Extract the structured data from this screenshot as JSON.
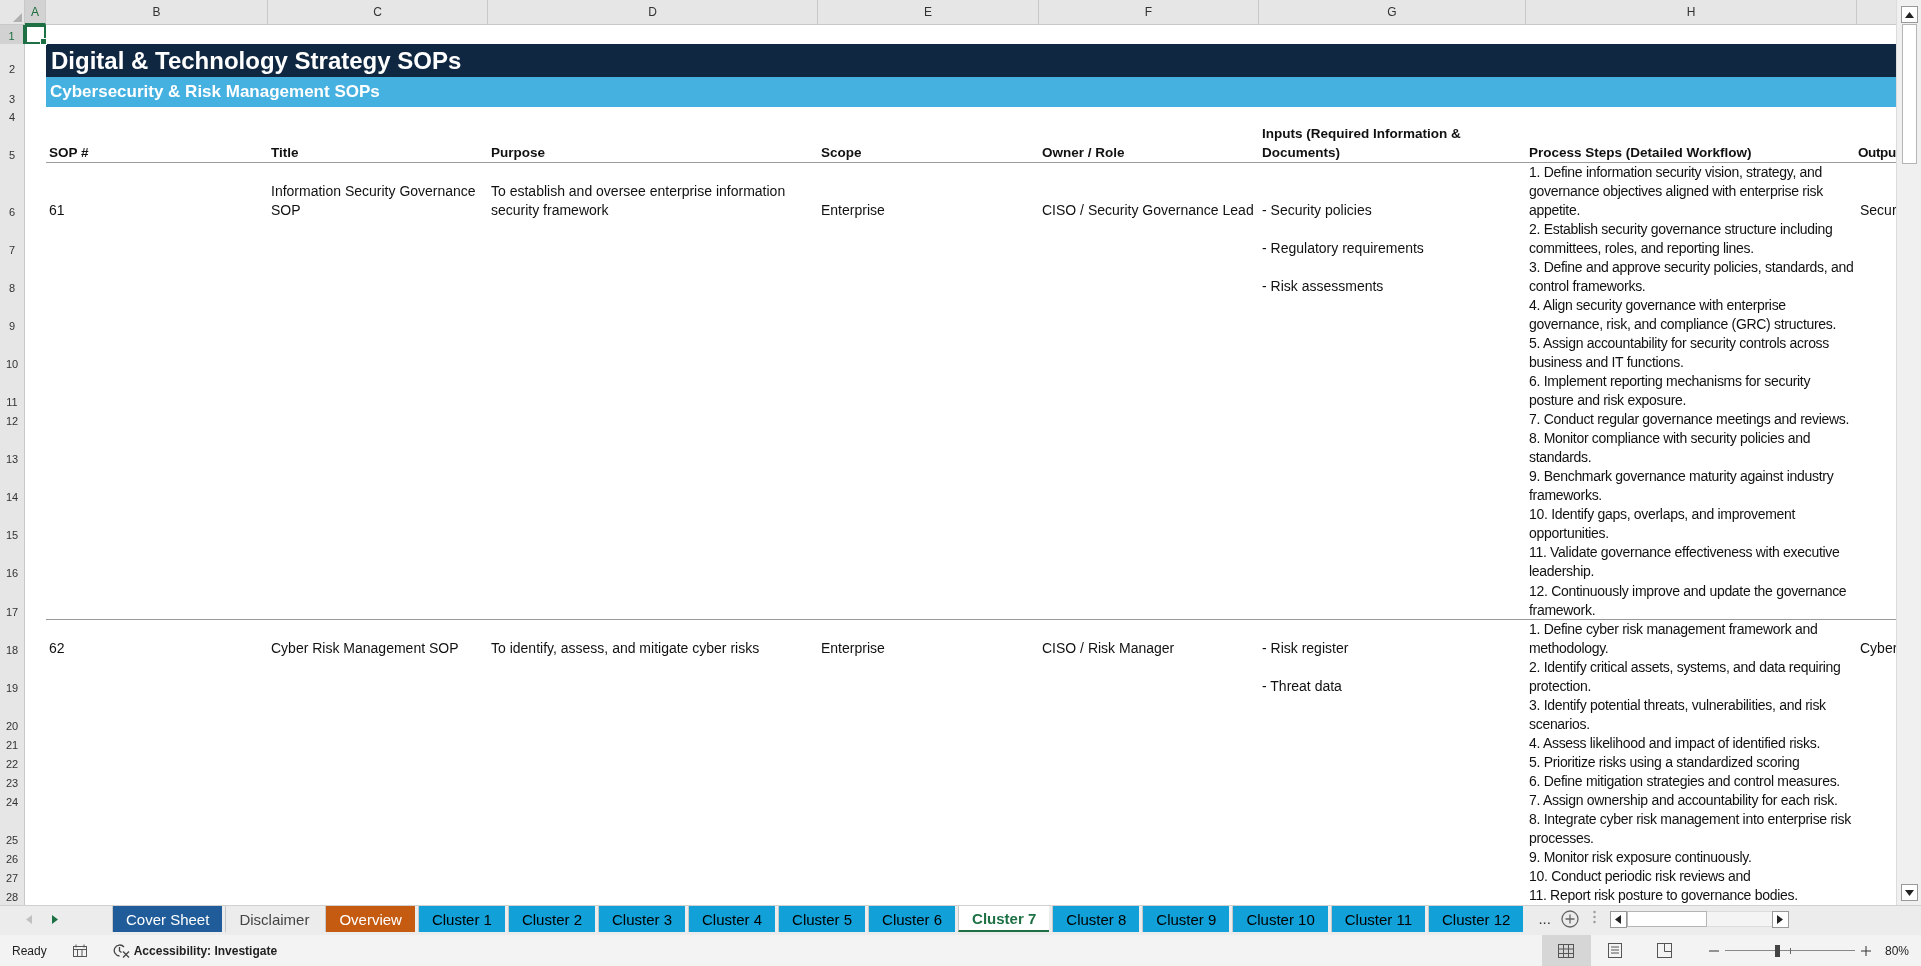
{
  "columns": [
    {
      "label": "A",
      "selected": true
    },
    {
      "label": "B",
      "selected": false
    },
    {
      "label": "C",
      "selected": false
    },
    {
      "label": "D",
      "selected": false
    },
    {
      "label": "E",
      "selected": false
    },
    {
      "label": "F",
      "selected": false
    },
    {
      "label": "G",
      "selected": false
    },
    {
      "label": "H",
      "selected": false
    }
  ],
  "row_numbers": [
    {
      "label": "1",
      "selected": true
    },
    {
      "label": "2",
      "selected": false
    },
    {
      "label": "3",
      "selected": false
    },
    {
      "label": "4",
      "selected": false
    },
    {
      "label": "5",
      "selected": false
    },
    {
      "label": "6",
      "selected": false
    },
    {
      "label": "7",
      "selected": false
    },
    {
      "label": "8",
      "selected": false
    },
    {
      "label": "9",
      "selected": false
    },
    {
      "label": "10",
      "selected": false
    },
    {
      "label": "11",
      "selected": false
    },
    {
      "label": "12",
      "selected": false
    },
    {
      "label": "13",
      "selected": false
    },
    {
      "label": "14",
      "selected": false
    },
    {
      "label": "15",
      "selected": false
    },
    {
      "label": "16",
      "selected": false
    },
    {
      "label": "17",
      "selected": false
    },
    {
      "label": "18",
      "selected": false
    },
    {
      "label": "19",
      "selected": false
    },
    {
      "label": "20",
      "selected": false
    },
    {
      "label": "21",
      "selected": false
    },
    {
      "label": "22",
      "selected": false
    },
    {
      "label": "23",
      "selected": false
    },
    {
      "label": "24",
      "selected": false
    },
    {
      "label": "25",
      "selected": false
    },
    {
      "label": "26",
      "selected": false
    },
    {
      "label": "27",
      "selected": false
    },
    {
      "label": "28",
      "selected": false
    }
  ],
  "title": "Digital & Technology Strategy SOPs",
  "subtitle": "Cybersecurity & Risk Management SOPs",
  "headers": [
    "SOP #",
    "Title",
    "Purpose",
    "Scope",
    "Owner / Role",
    "Inputs (Required Information & Documents)",
    "Process Steps (Detailed Workflow)",
    "Outpu"
  ],
  "sops": [
    {
      "number": "61",
      "title": "Information Security Governance SOP",
      "purpose": "To establish and oversee enterprise information security framework",
      "scope": "Enterprise",
      "owner": "CISO / Security Governance Lead",
      "inputs": [
        "- Security policies",
        "- Regulatory requirements",
        "- Risk assessments"
      ],
      "output": "Secur",
      "steps": [
        "1. Define information security vision, strategy, and governance objectives aligned with enterprise risk appetite.",
        "2. Establish security governance structure including committees, roles, and reporting lines.",
        "3. Define and approve security policies, standards, and control frameworks.",
        "4. Align security governance with enterprise governance, risk, and compliance (GRC) structures.",
        "5. Assign accountability for security controls across business and IT functions.",
        "6. Implement reporting mechanisms for security posture and risk exposure.",
        "7. Conduct regular governance meetings and reviews.",
        "8. Monitor compliance with security policies and standards.",
        "9. Benchmark governance maturity against industry frameworks.",
        "10. Identify gaps, overlaps, and improvement opportunities.",
        "11. Validate governance effectiveness with executive leadership.",
        "12. Continuously improve and update the governance framework."
      ]
    },
    {
      "number": "62",
      "title": "Cyber Risk Management SOP",
      "purpose": "To identify, assess, and mitigate cyber risks",
      "scope": "Enterprise",
      "owner": "CISO / Risk Manager",
      "inputs": [
        "- Risk register",
        "- Threat data"
      ],
      "output": "Cyber",
      "steps": [
        "1. Define cyber risk management framework and methodology.",
        "2. Identify critical assets, systems, and data requiring protection.",
        "3. Identify potential threats, vulnerabilities, and risk scenarios.",
        "4. Assess likelihood and impact of identified risks.",
        "5. Prioritize risks using a standardized scoring",
        "6. Define mitigation strategies and control measures.",
        "7. Assign ownership and accountability for each risk.",
        "8. Integrate cyber risk management into enterprise risk processes.",
        "9. Monitor risk exposure continuously.",
        "10. Conduct periodic risk reviews and",
        "11. Report risk posture to governance bodies."
      ]
    }
  ],
  "tab_nav": {
    "prev_disabled": true,
    "next_disabled": false
  },
  "sheet_tabs": [
    {
      "label": "Cover Sheet",
      "color": "#1f5c99",
      "selected": false
    },
    {
      "label": "Disclaimer",
      "selected": false
    },
    {
      "label": "Overview",
      "color": "#c55a11",
      "selected": false
    },
    {
      "label": "Cluster 1",
      "color": "#11a0d8",
      "selected": false
    },
    {
      "label": "Cluster 2",
      "color": "#11a0d8",
      "selected": false
    },
    {
      "label": "Cluster 3",
      "color": "#11a0d8",
      "selected": false
    },
    {
      "label": "Cluster 4",
      "color": "#11a0d8",
      "selected": false
    },
    {
      "label": "Cluster 5",
      "color": "#11a0d8",
      "selected": false
    },
    {
      "label": "Cluster 6",
      "color": "#11a0d8",
      "selected": false
    },
    {
      "label": "Cluster 7",
      "selected": true
    },
    {
      "label": "Cluster 8",
      "color": "#11a0d8",
      "selected": false
    },
    {
      "label": "Cluster 9",
      "color": "#11a0d8",
      "selected": false
    },
    {
      "label": "Cluster 10",
      "color": "#11a0d8",
      "selected": false
    },
    {
      "label": "Cluster 11",
      "color": "#11a0d8",
      "selected": false
    },
    {
      "label": "Cluster 12",
      "color": "#11a0d8",
      "selected": false
    }
  ],
  "tab_overflow": "...",
  "status": {
    "mode": "Ready",
    "accessibility": "Accessibility: Investigate",
    "zoom": "80%",
    "zoom_slider": {
      "level": 0.4
    },
    "views": [
      {
        "kind": "normal",
        "selected": true
      },
      {
        "kind": "layout",
        "selected": false
      },
      {
        "kind": "pagebreak",
        "selected": false
      }
    ]
  }
}
